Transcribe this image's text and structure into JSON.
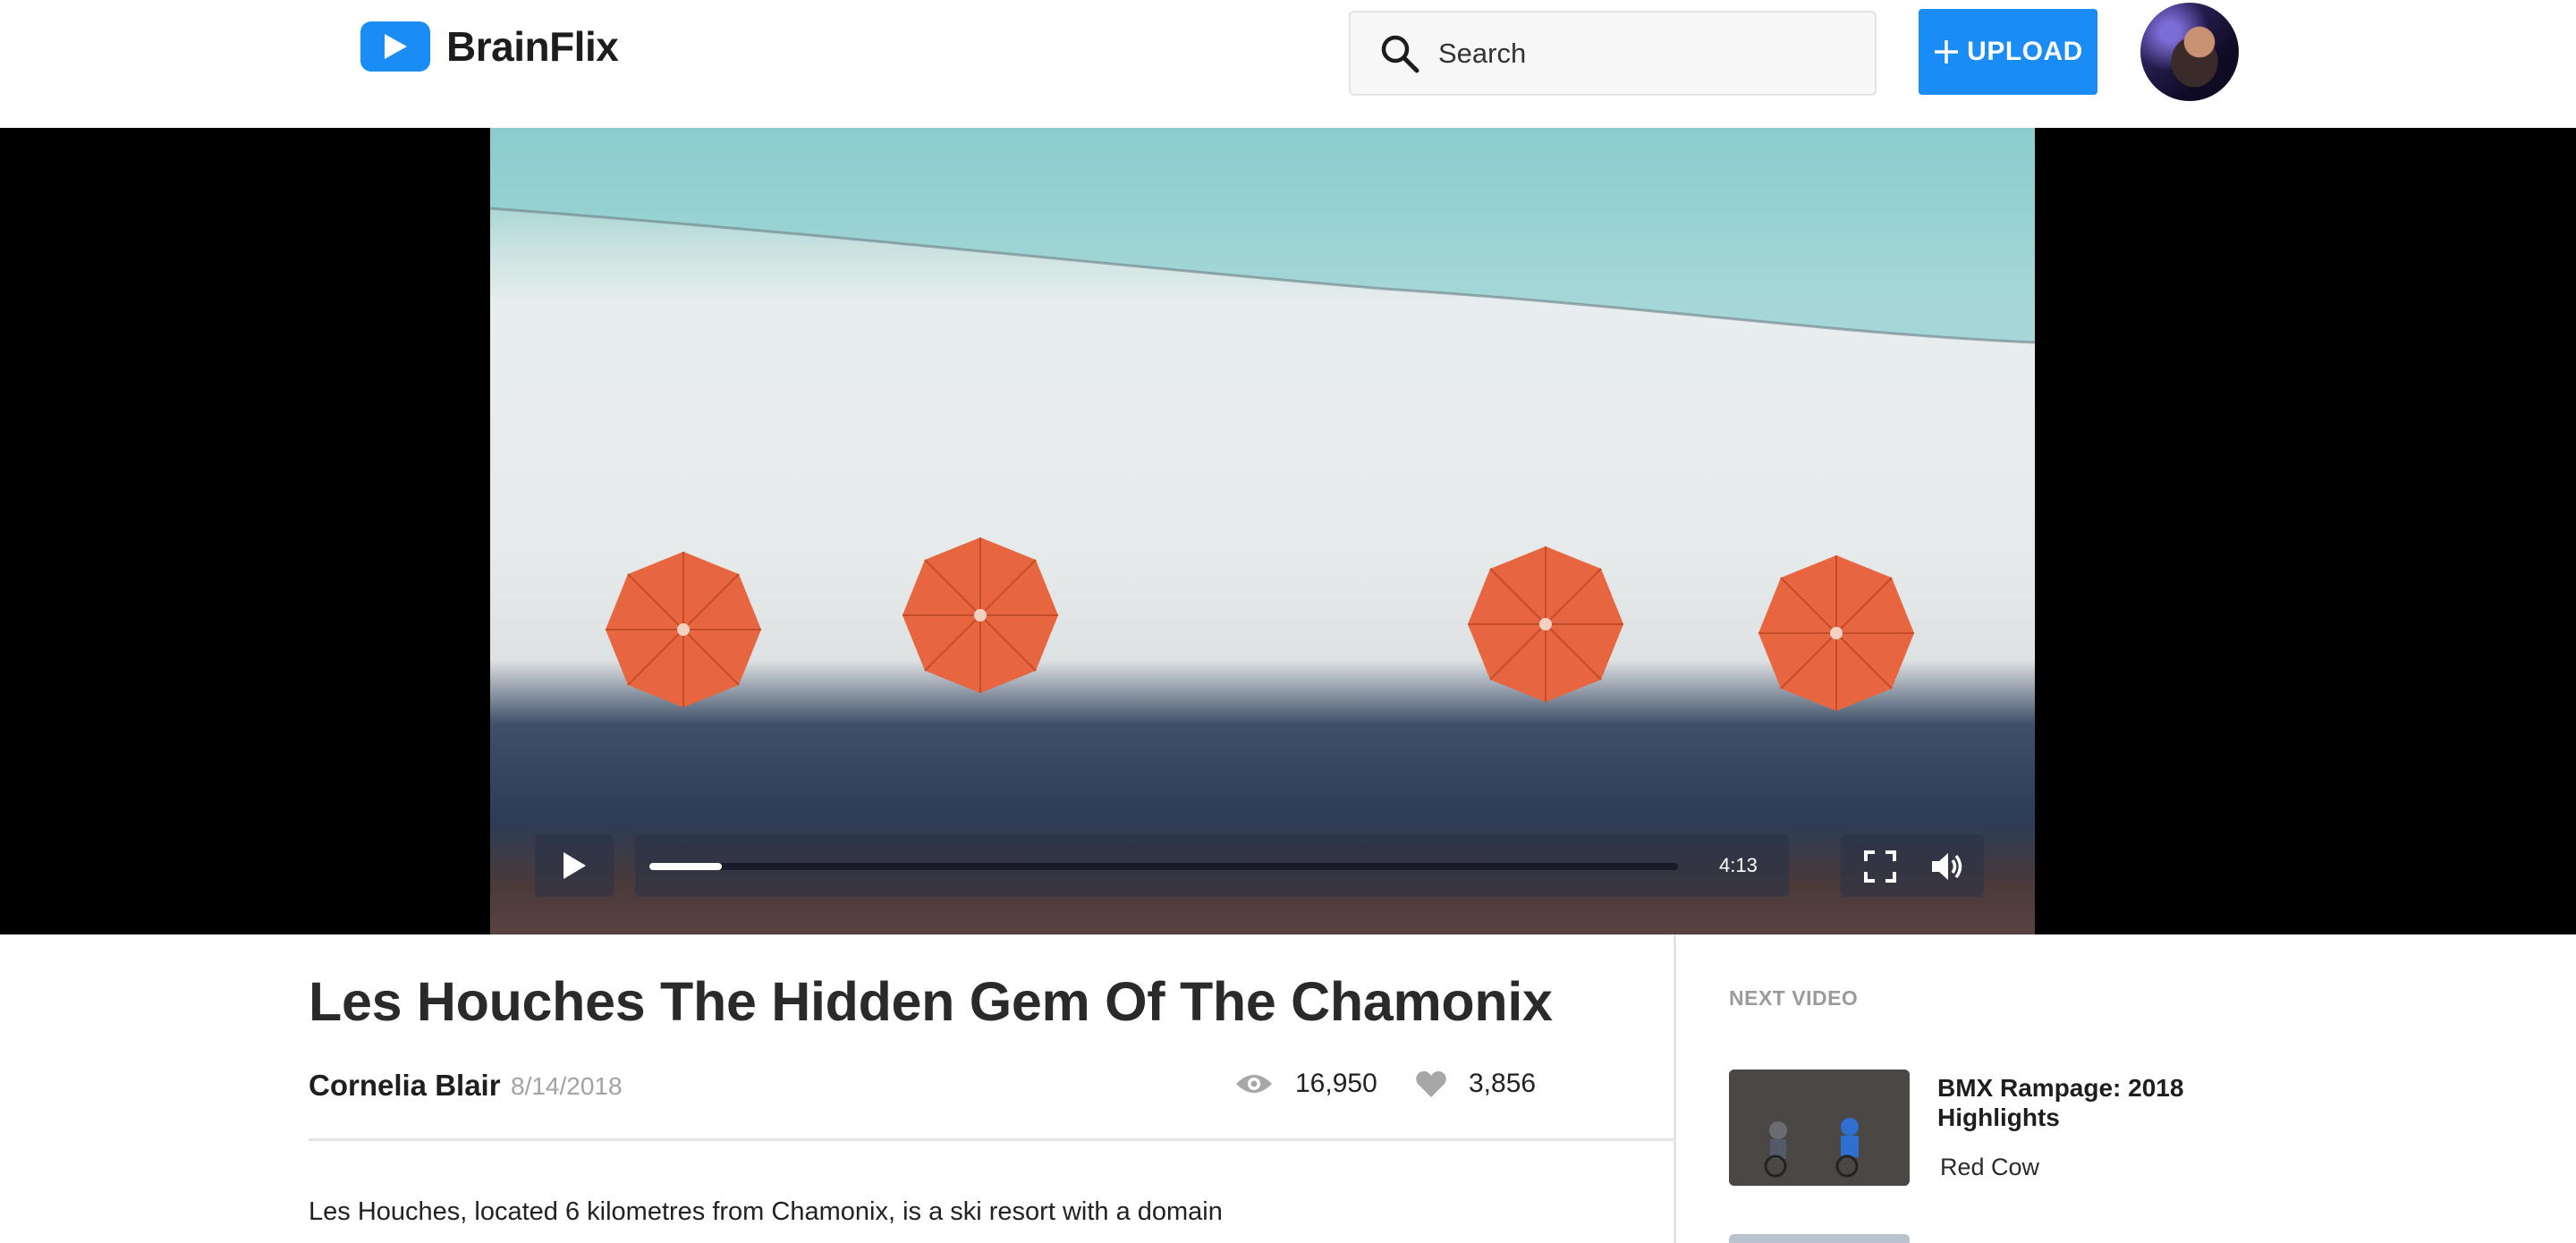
{
  "app": {
    "name": "BrainFlix",
    "accent": "#1a8cf5"
  },
  "header": {
    "logo_icon": "play-icon",
    "search": {
      "placeholder": "Search",
      "icon": "search-icon"
    },
    "upload_label": "UPLOAD",
    "upload_icon": "plus-icon",
    "avatar_icon": "user-avatar"
  },
  "player": {
    "play_icon": "play-icon",
    "progress_fraction": 0.07,
    "duration": "4:13",
    "fullscreen_icon": "fullscreen-icon",
    "volume_icon": "volume-icon"
  },
  "video": {
    "title": "Les Houches The Hidden Gem Of The Chamonix",
    "author": "Cornelia Blair",
    "date": "8/14/2018",
    "views": "16,950",
    "likes": "3,856",
    "views_icon": "eye-icon",
    "likes_icon": "heart-icon",
    "description": "Les Houches, located 6 kilometres from Chamonix, is a ski resort with a domain"
  },
  "sidebar": {
    "heading": "NEXT VIDEO",
    "items": [
      {
        "title": "BMX Rampage: 2018 Highlights",
        "author": "Red Cow"
      }
    ]
  }
}
